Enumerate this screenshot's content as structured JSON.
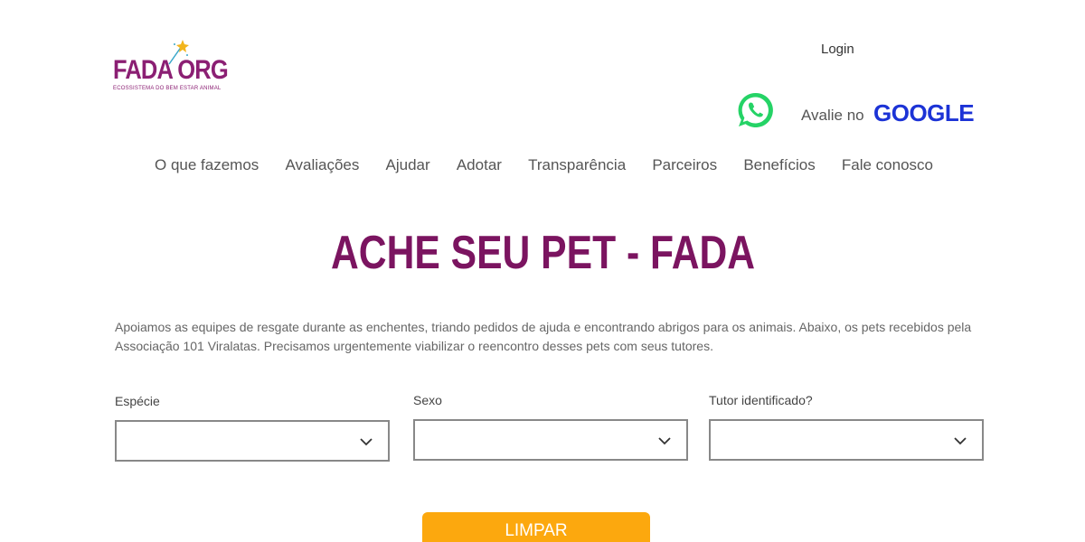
{
  "logo": {
    "text": "FADA ORG",
    "subtitle": "ECOSSISTEMA DO BEM ESTAR ANIMAL"
  },
  "header": {
    "login_label": "Login",
    "avalie_label": "Avalie no",
    "google_label": "GOOGLE"
  },
  "nav": {
    "items": [
      {
        "label": "O que fazemos"
      },
      {
        "label": "Avaliações"
      },
      {
        "label": "Ajudar"
      },
      {
        "label": "Adotar"
      },
      {
        "label": "Transparência"
      },
      {
        "label": "Parceiros"
      },
      {
        "label": "Benefícios"
      },
      {
        "label": "Fale conosco"
      }
    ]
  },
  "main": {
    "title": "ACHE SEU PET - FADA",
    "description": "Apoiamos as equipes de resgate durante as enchentes, triando pedidos de ajuda e encontrando abrigos para os animais. Abaixo, os pets recebidos pela Associação 101 Viralatas. Precisamos urgentemente viabilizar o reencontro desses pets com seus tutores."
  },
  "filters": {
    "especie": {
      "label": "Espécie",
      "value": ""
    },
    "sexo": {
      "label": "Sexo",
      "value": ""
    },
    "tutor": {
      "label": "Tutor identificado?",
      "value": ""
    }
  },
  "actions": {
    "clear_label": "LIMPAR"
  },
  "colors": {
    "brand": "#7b1460",
    "google": "#1c33d6",
    "whatsapp": "#25d366",
    "button": "#fca80e"
  }
}
